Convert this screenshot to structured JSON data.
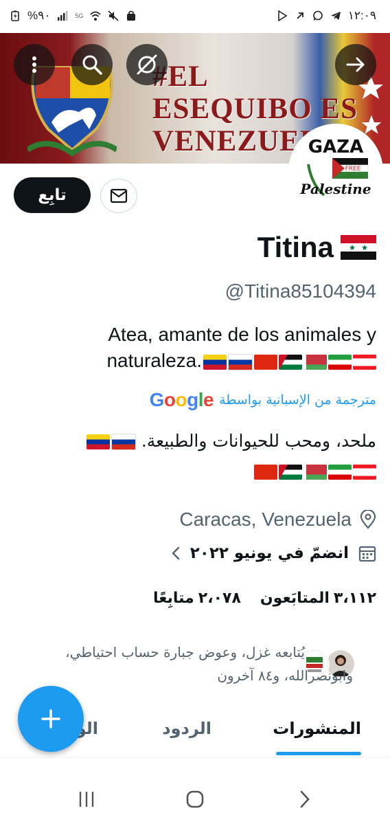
{
  "status_bar": {
    "time": "١٢:٠٩",
    "battery": "%٩٠",
    "network": "5G"
  },
  "banner": {
    "line1": "#EL",
    "line2": "ESEQUIBO ES",
    "line3": "VENEZUELA"
  },
  "avatar": {
    "line1": "GAZA",
    "line2": "FREE",
    "line3": "Palestine"
  },
  "profile": {
    "follow_label": "تابِع",
    "name": "Titina",
    "handle": "@Titina85104394",
    "bio_line1": "Atea, amante de los animales y",
    "bio_line2": "naturaleza.",
    "translated_by": "مترجمة من الإسبانية بواسطة",
    "google": "Google",
    "bio_ar_line1": "ملحد، ومحب للحيوانات والطبيعة.",
    "location": "Caracas, Venezuela",
    "joined": "انضمّ في يونيو ٢٠٢٢",
    "followers_count": "٣،١١٢",
    "followers_label": "المتابَعون",
    "following_count": "٢،٠٧٨",
    "following_label": "متابِعًا",
    "followed_by_line1": "يُتابعه غزل، وعوض جبارة حساب احتياطي،",
    "followed_by_line2": "وابونصرالله، و٨٤ آخرون"
  },
  "tabs": [
    {
      "label": "المنشورات"
    },
    {
      "label": "الردود"
    },
    {
      "label": "الو"
    }
  ],
  "colors": {
    "accent": "#1d9bf0",
    "text": "#0f1419",
    "muted": "#536471"
  }
}
